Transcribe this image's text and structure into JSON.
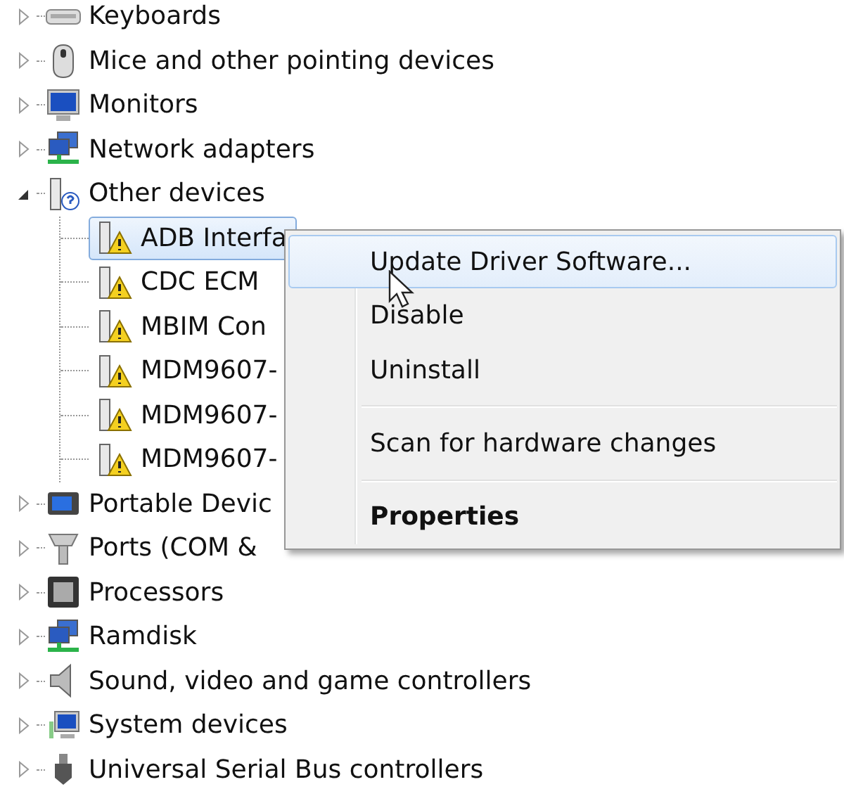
{
  "tree": [
    {
      "label": "Keyboards",
      "expanded": false,
      "selected": false
    },
    {
      "label": "Mice and other pointing devices",
      "expanded": false,
      "selected": false
    },
    {
      "label": "Monitors",
      "expanded": false,
      "selected": false
    },
    {
      "label": "Network adapters",
      "expanded": false,
      "selected": false
    },
    {
      "label": "Other devices",
      "expanded": true,
      "selected": false,
      "children": [
        {
          "label": "ADB Interfa",
          "selected": true
        },
        {
          "label": "CDC ECM",
          "selected": false
        },
        {
          "label": "MBIM Con",
          "selected": false
        },
        {
          "label": "MDM9607-",
          "selected": false
        },
        {
          "label": "MDM9607-",
          "selected": false
        },
        {
          "label": "MDM9607-",
          "selected": false
        }
      ]
    },
    {
      "label": "Portable Devic",
      "expanded": false,
      "selected": false
    },
    {
      "label": "Ports (COM &",
      "expanded": false,
      "selected": false
    },
    {
      "label": "Processors",
      "expanded": false,
      "selected": false
    },
    {
      "label": "Ramdisk",
      "expanded": false,
      "selected": false
    },
    {
      "label": "Sound, video and game controllers",
      "expanded": false,
      "selected": false
    },
    {
      "label": "System devices",
      "expanded": false,
      "selected": false
    },
    {
      "label": "Universal Serial Bus controllers",
      "expanded": false,
      "selected": false
    }
  ],
  "context_menu": {
    "items": [
      {
        "kind": "item",
        "label": "Update Driver Software...",
        "selected": true,
        "default": false
      },
      {
        "kind": "item",
        "label": "Disable",
        "selected": false,
        "default": false
      },
      {
        "kind": "item",
        "label": "Uninstall",
        "selected": false,
        "default": false
      },
      {
        "kind": "separator"
      },
      {
        "kind": "item",
        "label": "Scan for hardware changes",
        "selected": false,
        "default": false
      },
      {
        "kind": "separator"
      },
      {
        "kind": "item",
        "label": "Properties",
        "selected": false,
        "default": true
      }
    ]
  }
}
